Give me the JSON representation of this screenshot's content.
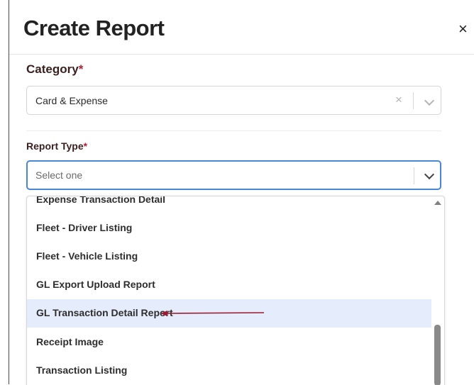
{
  "dialog": {
    "title": "Create Report",
    "close_glyph": "×"
  },
  "category": {
    "label": "Category",
    "required_mark": "*",
    "value": "Card & Expense",
    "clear_glyph": "×"
  },
  "report_type": {
    "label": "Report Type",
    "required_mark": "*",
    "placeholder": "Select one"
  },
  "dropdown": {
    "options": [
      "Expense Transaction Detail",
      "Fleet - Driver Listing",
      "Fleet - Vehicle Listing",
      "GL Export Upload Report",
      "GL Transaction Detail Report",
      "Receipt Image",
      "Transaction Listing"
    ],
    "highlighted_option": "GL Transaction Detail Report"
  },
  "colors": {
    "required": "#b2233a",
    "focus_border": "#4a86d6",
    "highlight_row": "#e5ecfb",
    "annotation_arrow": "#9b1b30"
  },
  "icons": [
    "close-icon",
    "clear-icon",
    "chevron-down-icon",
    "scroll-up-icon",
    "annotation-arrow-icon"
  ]
}
